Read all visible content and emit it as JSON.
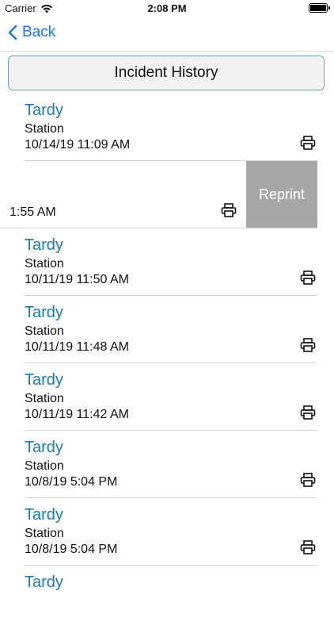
{
  "status_bar": {
    "carrier": "Carrier",
    "time": "2:08 PM"
  },
  "nav": {
    "back_label": "Back"
  },
  "header": {
    "title": "Incident History"
  },
  "swiped_row": {
    "date_fragment": "1:55 AM",
    "action_label": "Reprint"
  },
  "incidents": [
    {
      "title": "Tardy",
      "subtitle": "Station",
      "date": "10/14/19 11:09 AM"
    },
    {
      "title": "Tardy",
      "subtitle": "Station",
      "date": "10/11/19 11:50 AM"
    },
    {
      "title": "Tardy",
      "subtitle": "Station",
      "date": "10/11/19 11:48 AM"
    },
    {
      "title": "Tardy",
      "subtitle": "Station",
      "date": "10/11/19 11:42 AM"
    },
    {
      "title": "Tardy",
      "subtitle": "Station",
      "date": "10/8/19 5:04 PM"
    },
    {
      "title": "Tardy",
      "subtitle": "Station",
      "date": "10/8/19 5:04 PM"
    },
    {
      "title": "Tardy",
      "subtitle": "",
      "date": ""
    }
  ],
  "icons": {
    "print": "printer-icon",
    "back": "chevron-left-icon",
    "wifi": "wifi-icon",
    "battery": "battery-icon"
  },
  "colors": {
    "accent": "#1a7ae5",
    "title_blue": "#1a7ab7",
    "reprint_bg": "#a7a7a7"
  }
}
